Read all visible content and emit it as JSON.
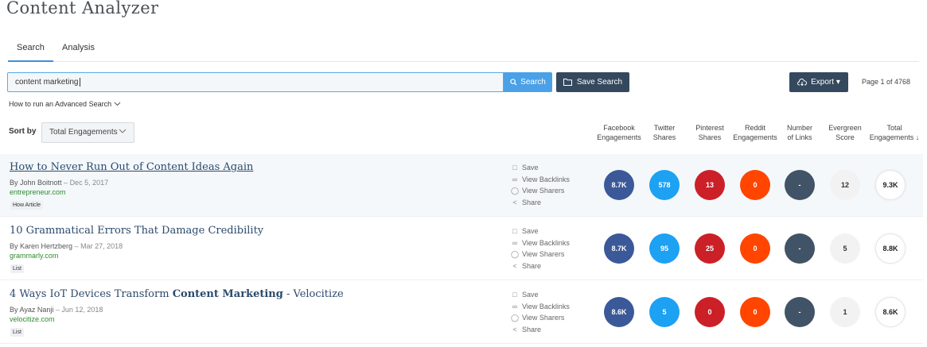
{
  "app": {
    "title": "Content Analyzer"
  },
  "tabs": [
    {
      "label": "Search"
    },
    {
      "label": "Analysis"
    }
  ],
  "search": {
    "value": "content marketing",
    "button_label": "Search",
    "save_label": "Save Search"
  },
  "export": {
    "label": "Export ▾"
  },
  "pagination": {
    "text": "Page 1 of 4768"
  },
  "advanced_search": {
    "label": "How to run an Advanced Search"
  },
  "sort": {
    "label": "Sort by",
    "selected": "Total Engagements"
  },
  "columns": [
    {
      "line1": "Facebook",
      "line2": "Engagements"
    },
    {
      "line1": "Twitter",
      "line2": "Shares"
    },
    {
      "line1": "Pinterest",
      "line2": "Shares"
    },
    {
      "line1": "Reddit",
      "line2": "Engagements"
    },
    {
      "line1": "Number",
      "line2": "of Links"
    },
    {
      "line1": "Evergreen",
      "line2": "Score"
    },
    {
      "line1": "Total",
      "line2": "Engagements ↓"
    }
  ],
  "actions": {
    "save": "Save",
    "backlinks": "View Backlinks",
    "sharers": "View Sharers",
    "share": "Share"
  },
  "colors": {
    "facebook": "#3b5998",
    "twitter": "#1da1f2",
    "pinterest": "#cb2027",
    "reddit": "#ff4500",
    "links": "#415366",
    "evergreen": "#f2f2f2",
    "total": "#ffffff"
  },
  "results": [
    {
      "title": "How to Never Run Out of Content Ideas Again",
      "title_bold": "",
      "title_tail": "",
      "author": "By John Boitnott",
      "date": "Dec 5, 2017",
      "domain": "entrepreneur.com",
      "badge": "How Article",
      "facebook": "8.7K",
      "twitter": "578",
      "pinterest": "13",
      "reddit": "0",
      "links": "-",
      "evergreen": "12",
      "total": "9.3K"
    },
    {
      "title": "10 Grammatical Errors That Damage Credibility",
      "title_bold": "",
      "title_tail": "",
      "author": "By Karen Hertzberg",
      "date": "Mar 27, 2018",
      "domain": "grammarly.com",
      "badge": "List",
      "facebook": "8.7K",
      "twitter": "95",
      "pinterest": "25",
      "reddit": "0",
      "links": "-",
      "evergreen": "5",
      "total": "8.8K"
    },
    {
      "title": "4 Ways IoT Devices Transform ",
      "title_bold": "Content Marketing",
      "title_tail": " - Velocitize",
      "author": "By Ayaz Nanji",
      "date": "Jun 12, 2018",
      "domain": "velocitize.com",
      "badge": "List",
      "facebook": "8.6K",
      "twitter": "5",
      "pinterest": "0",
      "reddit": "0",
      "links": "-",
      "evergreen": "1",
      "total": "8.6K"
    }
  ]
}
